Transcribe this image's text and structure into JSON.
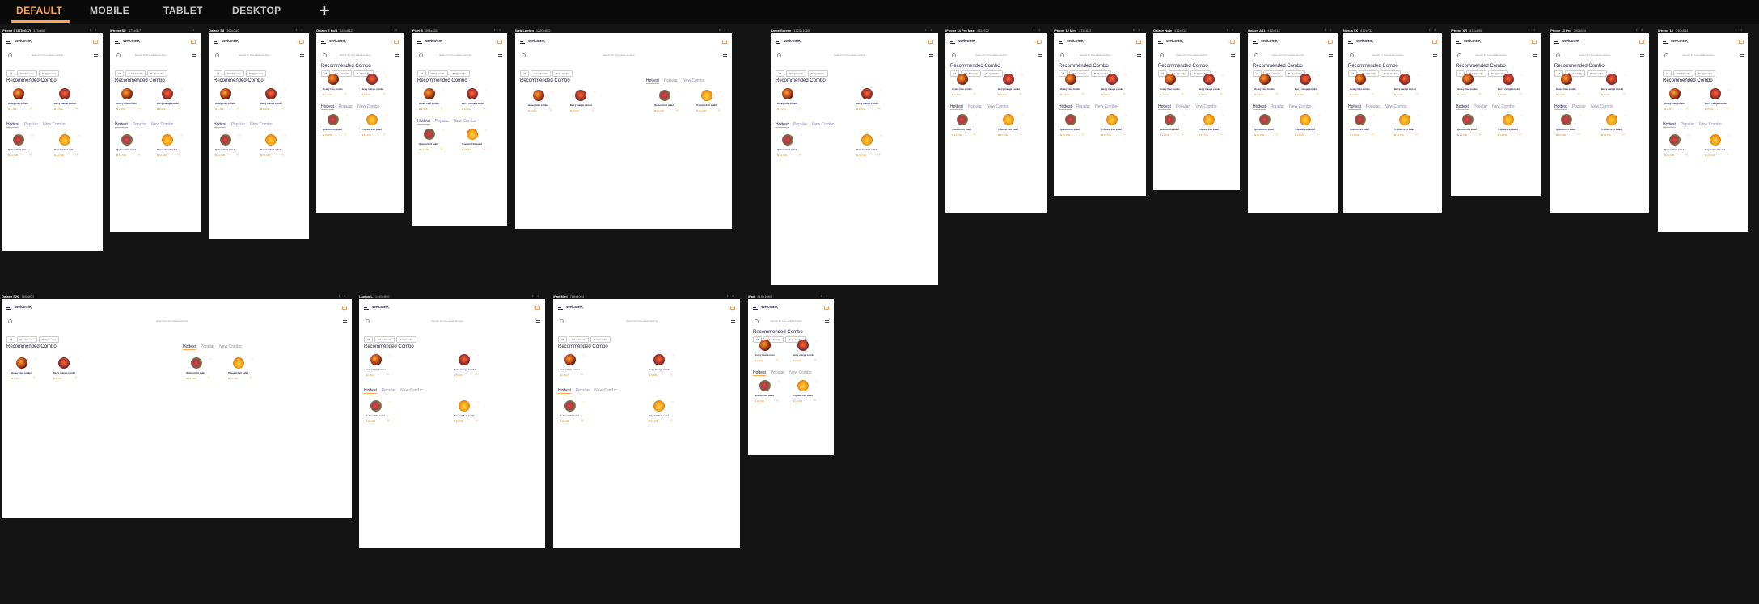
{
  "tabs": [
    "DEFAULT",
    "MOBILE",
    "TABLET",
    "DESKTOP"
  ],
  "active_tab": "DEFAULT",
  "add_label": "+",
  "device_controls": "• •",
  "app": {
    "welcome": "Welcome,",
    "search_placeholder": "Search for fruit salad combos",
    "chips": [
      "All",
      "Salad Combo",
      "Berry Combo"
    ],
    "recommended_title": "Recommended Combo",
    "section_tabs": [
      "Hottest",
      "Popular",
      "New Combo"
    ],
    "heart": "♡",
    "add": "+",
    "products": [
      {
        "name": "Honey lime combo",
        "price": "₦ 2,000",
        "img": "f-honey"
      },
      {
        "name": "Berry mango combo",
        "price": "₦ 8,000",
        "img": "f-berry"
      },
      {
        "name": "Quinoa fruit salad",
        "price": "₦ 10,000",
        "img": "f-quinoa"
      },
      {
        "name": "Tropical fruit salad",
        "price": "₦ 10,000",
        "img": "f-tropical"
      }
    ]
  },
  "devices": [
    {
      "name": "iPhone 8 (375×667)",
      "size": "375x667"
    },
    {
      "name": "iPhone SE",
      "size": "375x667"
    },
    {
      "name": "Galaxy S8",
      "size": "360x740"
    },
    {
      "name": "Galaxy Z Fold",
      "size": "344x882"
    },
    {
      "name": "Pixel 5",
      "size": "393x851"
    },
    {
      "name": "Web Laptop",
      "size": "1280x800"
    },
    {
      "name": "Large Screen",
      "size": "1920x1080"
    },
    {
      "name": "iPhone 14 Pro Max",
      "size": "430x932"
    },
    {
      "name": "iPhone 12 Mini",
      "size": "375x812"
    },
    {
      "name": "Galaxy Note",
      "size": "412x915"
    },
    {
      "name": "Galaxy A51",
      "size": "412x914"
    },
    {
      "name": "Nexus 5X",
      "size": "412x732"
    },
    {
      "name": "iPhone XR",
      "size": "414x896"
    },
    {
      "name": "iPhone 13 Pro",
      "size": "390x844"
    },
    {
      "name": "iPhone 13",
      "size": "390x844"
    },
    {
      "name": "Galaxy S20",
      "size": "360x800"
    },
    {
      "name": "Laptop L",
      "size": "1440x900"
    },
    {
      "name": "iPad Mini",
      "size": "768x1024"
    },
    {
      "name": "iPad",
      "size": "810x1080"
    },
    {
      "name": "Galaxy S9",
      "size": "360x740"
    }
  ]
}
